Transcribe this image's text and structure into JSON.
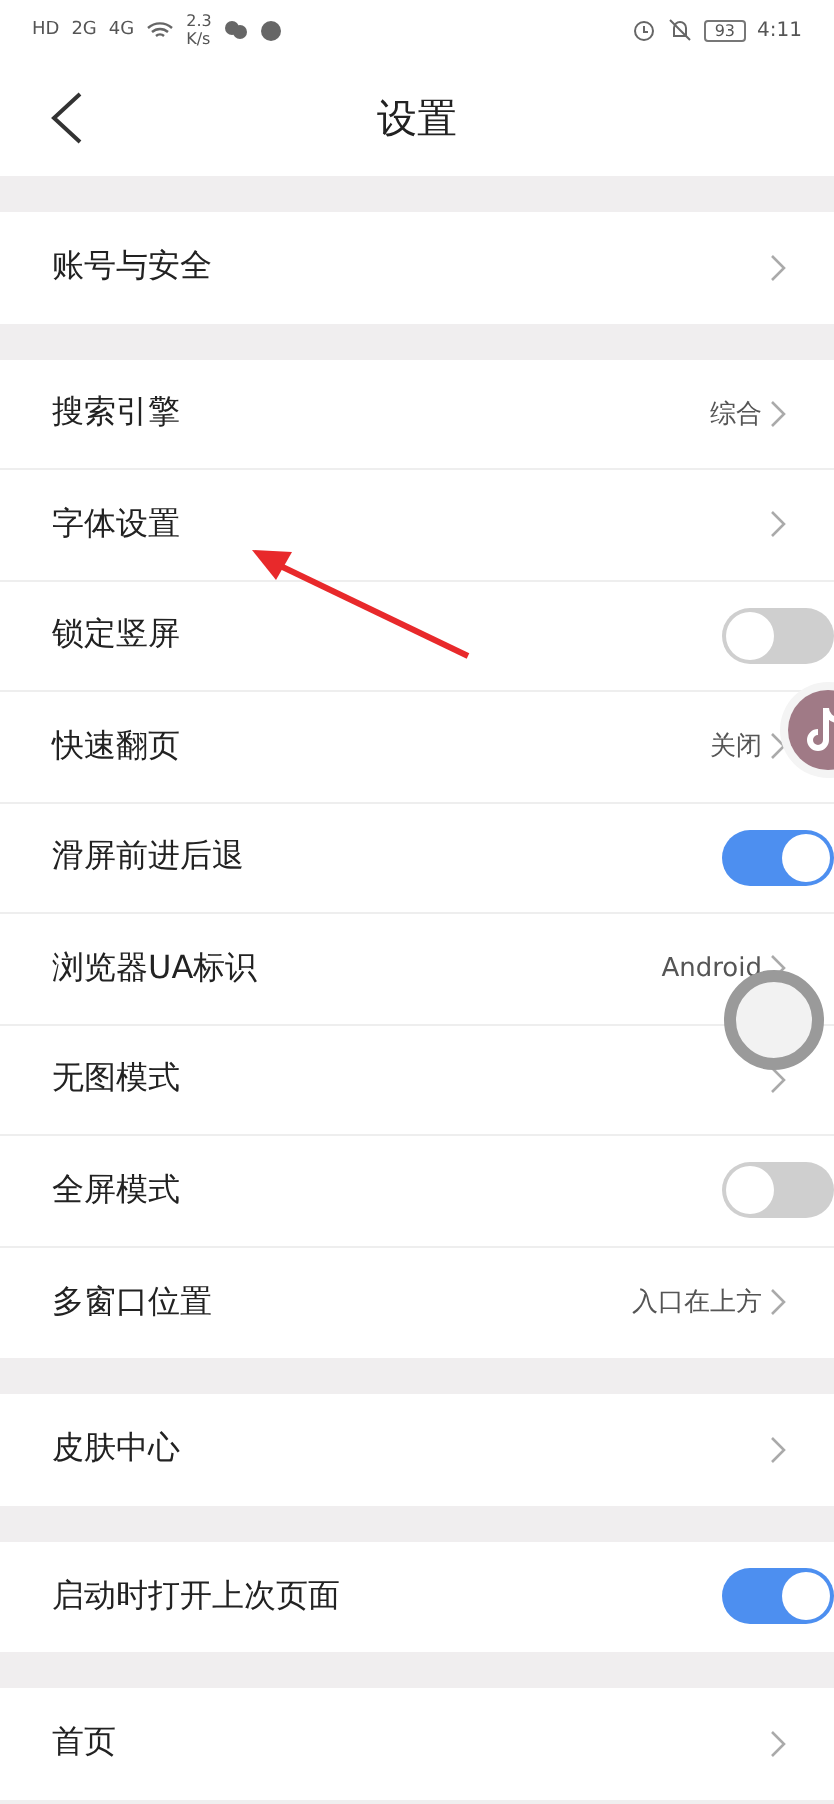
{
  "status_bar": {
    "left": [
      "HD",
      "2G",
      "4G"
    ],
    "speed": [
      "2.3",
      "K/s"
    ],
    "battery": "93",
    "time": "4:11"
  },
  "header": {
    "title": "设置"
  },
  "groups": [
    {
      "rows": [
        {
          "label": "账号与安全",
          "kind": "link"
        }
      ]
    },
    {
      "rows": [
        {
          "label": "搜索引擎",
          "kind": "link",
          "value": "综合"
        },
        {
          "label": "字体设置",
          "kind": "link"
        },
        {
          "label": "锁定竖屏",
          "kind": "switch",
          "on": false
        },
        {
          "label": "快速翻页",
          "kind": "link",
          "value": "关闭"
        },
        {
          "label": "滑屏前进后退",
          "kind": "switch",
          "on": true
        },
        {
          "label": "浏览器UA标识",
          "kind": "link",
          "value": "Android"
        },
        {
          "label": "无图模式",
          "kind": "link"
        },
        {
          "label": "全屏模式",
          "kind": "switch",
          "on": false
        },
        {
          "label": "多窗口位置",
          "kind": "link",
          "value": "入口在上方"
        }
      ]
    },
    {
      "rows": [
        {
          "label": "皮肤中心",
          "kind": "link"
        }
      ]
    },
    {
      "rows": [
        {
          "label": "启动时打开上次页面",
          "kind": "switch",
          "on": true
        }
      ]
    },
    {
      "rows": [
        {
          "label": "首页",
          "kind": "link"
        }
      ]
    }
  ]
}
